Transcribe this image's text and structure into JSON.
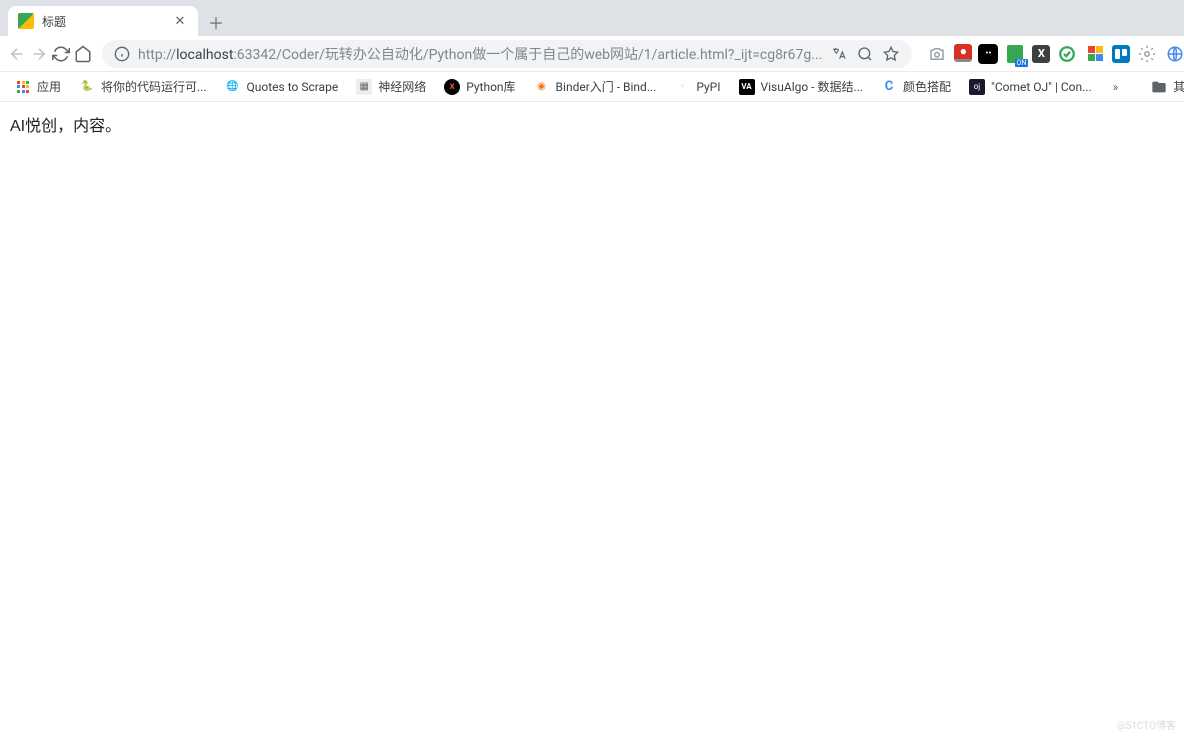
{
  "tab": {
    "title": "标题"
  },
  "omnibox": {
    "scheme": "http://",
    "host": "localhost",
    "path": ":63342/Coder/玩转办公自动化/Python做一个属于自己的web网站/1/article.html?_ijt=cg8r67g..."
  },
  "bookmarks": {
    "apps": "应用",
    "items": [
      {
        "label": "将你的代码运行可...",
        "icon_bg": "#fff",
        "icon_text": "🐍"
      },
      {
        "label": "Quotes to Scrape",
        "icon_bg": "#fff",
        "icon_text": "🌐"
      },
      {
        "label": "神经网络",
        "icon_bg": "#eee",
        "icon_text": "回"
      },
      {
        "label": "Python库",
        "icon_bg": "#000",
        "icon_text": "X",
        "color": "#ea4335"
      },
      {
        "label": "Binder入门 - Bind...",
        "icon_bg": "#fff",
        "icon_text": "◉"
      },
      {
        "label": "PyPI",
        "icon_bg": "#fff",
        "icon_text": "◻"
      },
      {
        "label": "VisuAlgo - 数据结...",
        "icon_bg": "#000",
        "icon_text": "VA",
        "color": "#fff"
      },
      {
        "label": "颜色搭配",
        "icon_bg": "#fff",
        "icon_text": "C",
        "color": "#4285f4"
      },
      {
        "label": "\"Comet OJ\" | Con...",
        "icon_bg": "#1a1a2e",
        "icon_text": "oj",
        "color": "#fff"
      }
    ],
    "overflow": "»",
    "other": "其他书签"
  },
  "page": {
    "text": "AI悦创，内容。"
  },
  "watermark": "@51CTO博客"
}
